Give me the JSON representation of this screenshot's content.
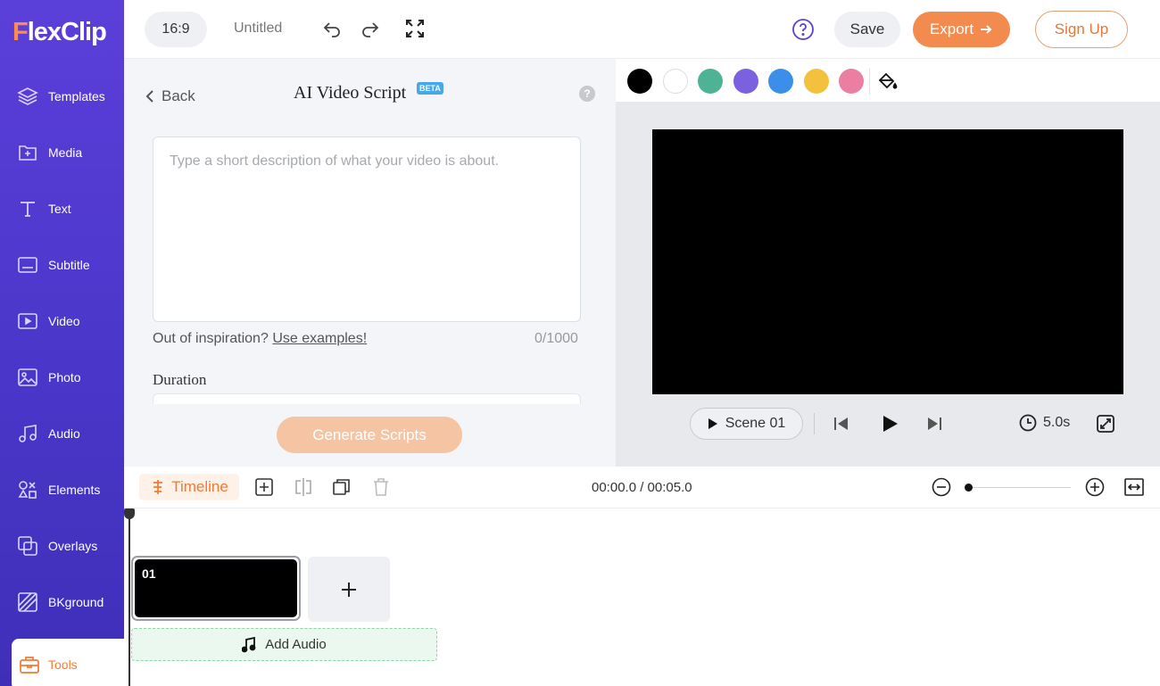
{
  "app": {
    "logo_text_first": "F",
    "logo_text_rest": "lexClip",
    "brand_orange": "#f28b4d",
    "brand_purple": "#5b3fd9"
  },
  "sidebar": {
    "items": [
      {
        "label": "Templates",
        "icon": "layers-icon"
      },
      {
        "label": "Media",
        "icon": "folder-plus-icon"
      },
      {
        "label": "Text",
        "icon": "text-icon"
      },
      {
        "label": "Subtitle",
        "icon": "subtitle-icon"
      },
      {
        "label": "Video",
        "icon": "video-icon"
      },
      {
        "label": "Photo",
        "icon": "photo-icon"
      },
      {
        "label": "Audio",
        "icon": "music-icon"
      },
      {
        "label": "Elements",
        "icon": "elements-icon"
      },
      {
        "label": "Overlays",
        "icon": "overlays-icon"
      },
      {
        "label": "BKground",
        "icon": "background-icon"
      },
      {
        "label": "Tools",
        "icon": "toolbox-icon",
        "active": true
      }
    ]
  },
  "topbar": {
    "ratio": "16:9",
    "title": "Untitled",
    "save_label": "Save",
    "export_label": "Export",
    "signup_label": "Sign Up"
  },
  "panel": {
    "back_label": "Back",
    "title": "AI Video Script",
    "badge": "BETA",
    "help": "?",
    "description_placeholder": "Type a short description of what your video is about.",
    "description_value": "",
    "inspiration_text": "Out of inspiration?",
    "inspiration_link": "Use examples!",
    "char_counter": "0/1000",
    "duration_label": "Duration",
    "generate_label": "Generate Scripts"
  },
  "colors": {
    "swatches": [
      "#000000",
      "#ffffff",
      "#4db394",
      "#7b61e0",
      "#3b8fe8",
      "#f4c13f",
      "#ea7fa1"
    ]
  },
  "preview": {
    "scene_label": "Scene 01",
    "duration": "5.0s"
  },
  "timeline": {
    "tab_label": "Timeline",
    "time_display": "00:00.0 / 00:05.0",
    "zoom_level": 0,
    "clip_number": "01",
    "add_audio_label": "Add Audio"
  }
}
